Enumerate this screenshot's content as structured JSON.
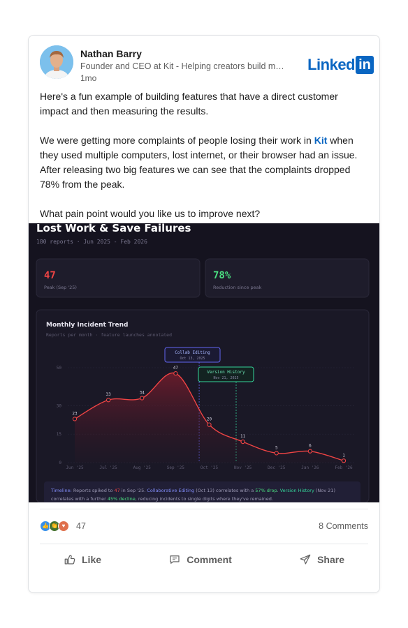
{
  "post": {
    "author_name": "Nathan Barry",
    "author_subtitle": "Founder and CEO at Kit - Helping creators build m…",
    "time_ago": "1mo",
    "network_logo_text": "Linked",
    "network_logo_box": "in",
    "paragraph_1": "Here's a fun example of building features that have a direct customer impact and then measuring the results.",
    "paragraph_2_before": "We were getting more complaints of people losing their work in ",
    "paragraph_2_link": "Kit",
    "paragraph_2_after": " when they used multiple computers, lost internet, or their browser had an issue. After releasing two big features we can see that the complaints dropped 78% from the peak.",
    "paragraph_3": "What pain point would you like us to improve next?"
  },
  "media": {
    "title": "Lost Work & Save Failures",
    "subtitle": "180 reports · Jun 2025 - Feb 2026",
    "stat_cards": [
      {
        "value": "47",
        "label": "Peak (Sep '25)",
        "color": "#ef4444"
      },
      {
        "value": "78%",
        "label": "Reduction since peak",
        "color": "#4ade80"
      }
    ],
    "chart_panel_title": "Monthly Incident Trend",
    "chart_panel_subtitle": "Reports per month · feature launches annotated",
    "annotations": [
      {
        "title": "Collab Editing",
        "date": "Oct 13, 2025"
      },
      {
        "title": "Version History",
        "date": "Nov 21, 2025"
      }
    ],
    "timeline_label": "Timeline:",
    "timeline_parts": [
      " Reports spiked to ",
      "47",
      " in Sep '25. ",
      "Collaborative Editing",
      " (Oct 13) correlates with a ",
      "57% drop",
      ". ",
      "Version History",
      " (Nov 21)",
      "correlates with a further ",
      "45% decline",
      ", reducing incidents to single digits where they've remained."
    ]
  },
  "chart_data": {
    "type": "area",
    "title": "Monthly Incident Trend",
    "categories": [
      "Jun '25",
      "Jul '25",
      "Aug '25",
      "Sep '25",
      "Oct '25",
      "Nov '25",
      "Dec '25",
      "Jan '26",
      "Feb '26"
    ],
    "values": [
      23,
      33,
      34,
      47,
      20,
      11,
      5,
      6,
      1
    ],
    "y_ticks": [
      "50",
      "30",
      "15",
      "0"
    ],
    "ylim": [
      0,
      50
    ],
    "line_color": "#ef4444",
    "grid": true
  },
  "engagement": {
    "reaction_count": "47",
    "comments_label": "8 Comments"
  },
  "actions": {
    "like": "Like",
    "comment": "Comment",
    "share": "Share"
  }
}
